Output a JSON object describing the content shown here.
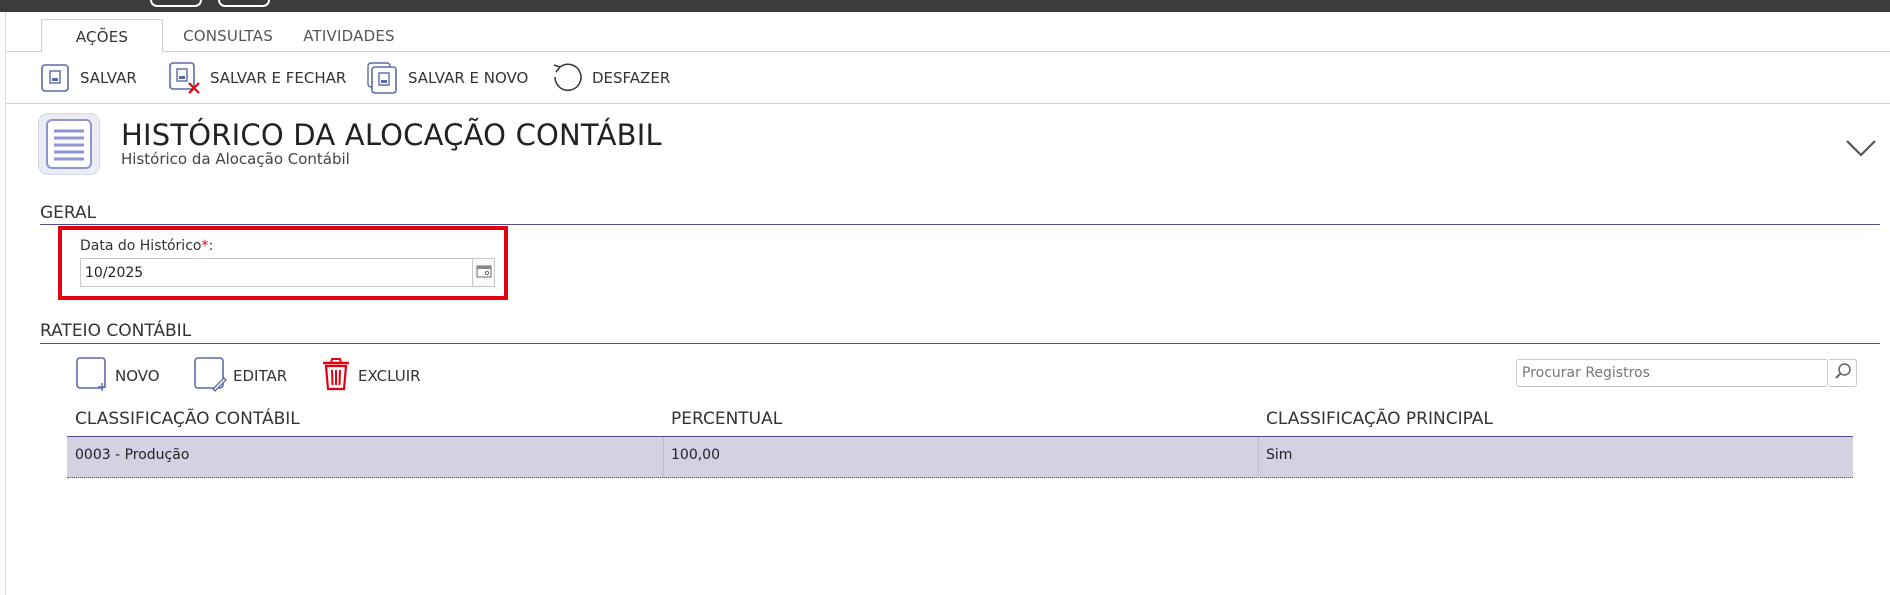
{
  "ribbon": {
    "tabs": [
      {
        "label": "AÇÕES",
        "active": true
      },
      {
        "label": "CONSULTAS",
        "active": false
      },
      {
        "label": "ATIVIDADES",
        "active": false
      }
    ]
  },
  "toolbar": {
    "save": "SALVAR",
    "save_close": "SALVAR E FECHAR",
    "save_new": "SALVAR E NOVO",
    "undo": "DESFAZER"
  },
  "header": {
    "title": "HISTÓRICO DA ALOCAÇÃO CONTÁBIL",
    "subtitle": "Histórico da Alocação Contábil",
    "icon": "document-list-icon"
  },
  "general": {
    "section_title": "GERAL",
    "date_label": "Data do Histórico",
    "required_mark": "*",
    "label_suffix": ":",
    "date_value": "10/2025"
  },
  "allocation": {
    "section_title": "RATEIO CONTÁBIL",
    "buttons": {
      "new": "NOVO",
      "edit": "EDITAR",
      "delete": "EXCLUIR"
    },
    "search_placeholder": "Procurar Registros",
    "columns": [
      "CLASSIFICAÇÃO CONTÁBIL",
      "PERCENTUAL",
      "CLASSIFICAÇÃO PRINCIPAL"
    ],
    "rows": [
      [
        "0003 - Produção",
        "100,00",
        "Sim"
      ]
    ]
  },
  "colors": {
    "accent": "#4a4a8c",
    "row_selected": "#d2d2e3",
    "highlight": "#e3000f",
    "delete_icon": "#e3000f",
    "icon_stroke": "#5a6aa8"
  }
}
